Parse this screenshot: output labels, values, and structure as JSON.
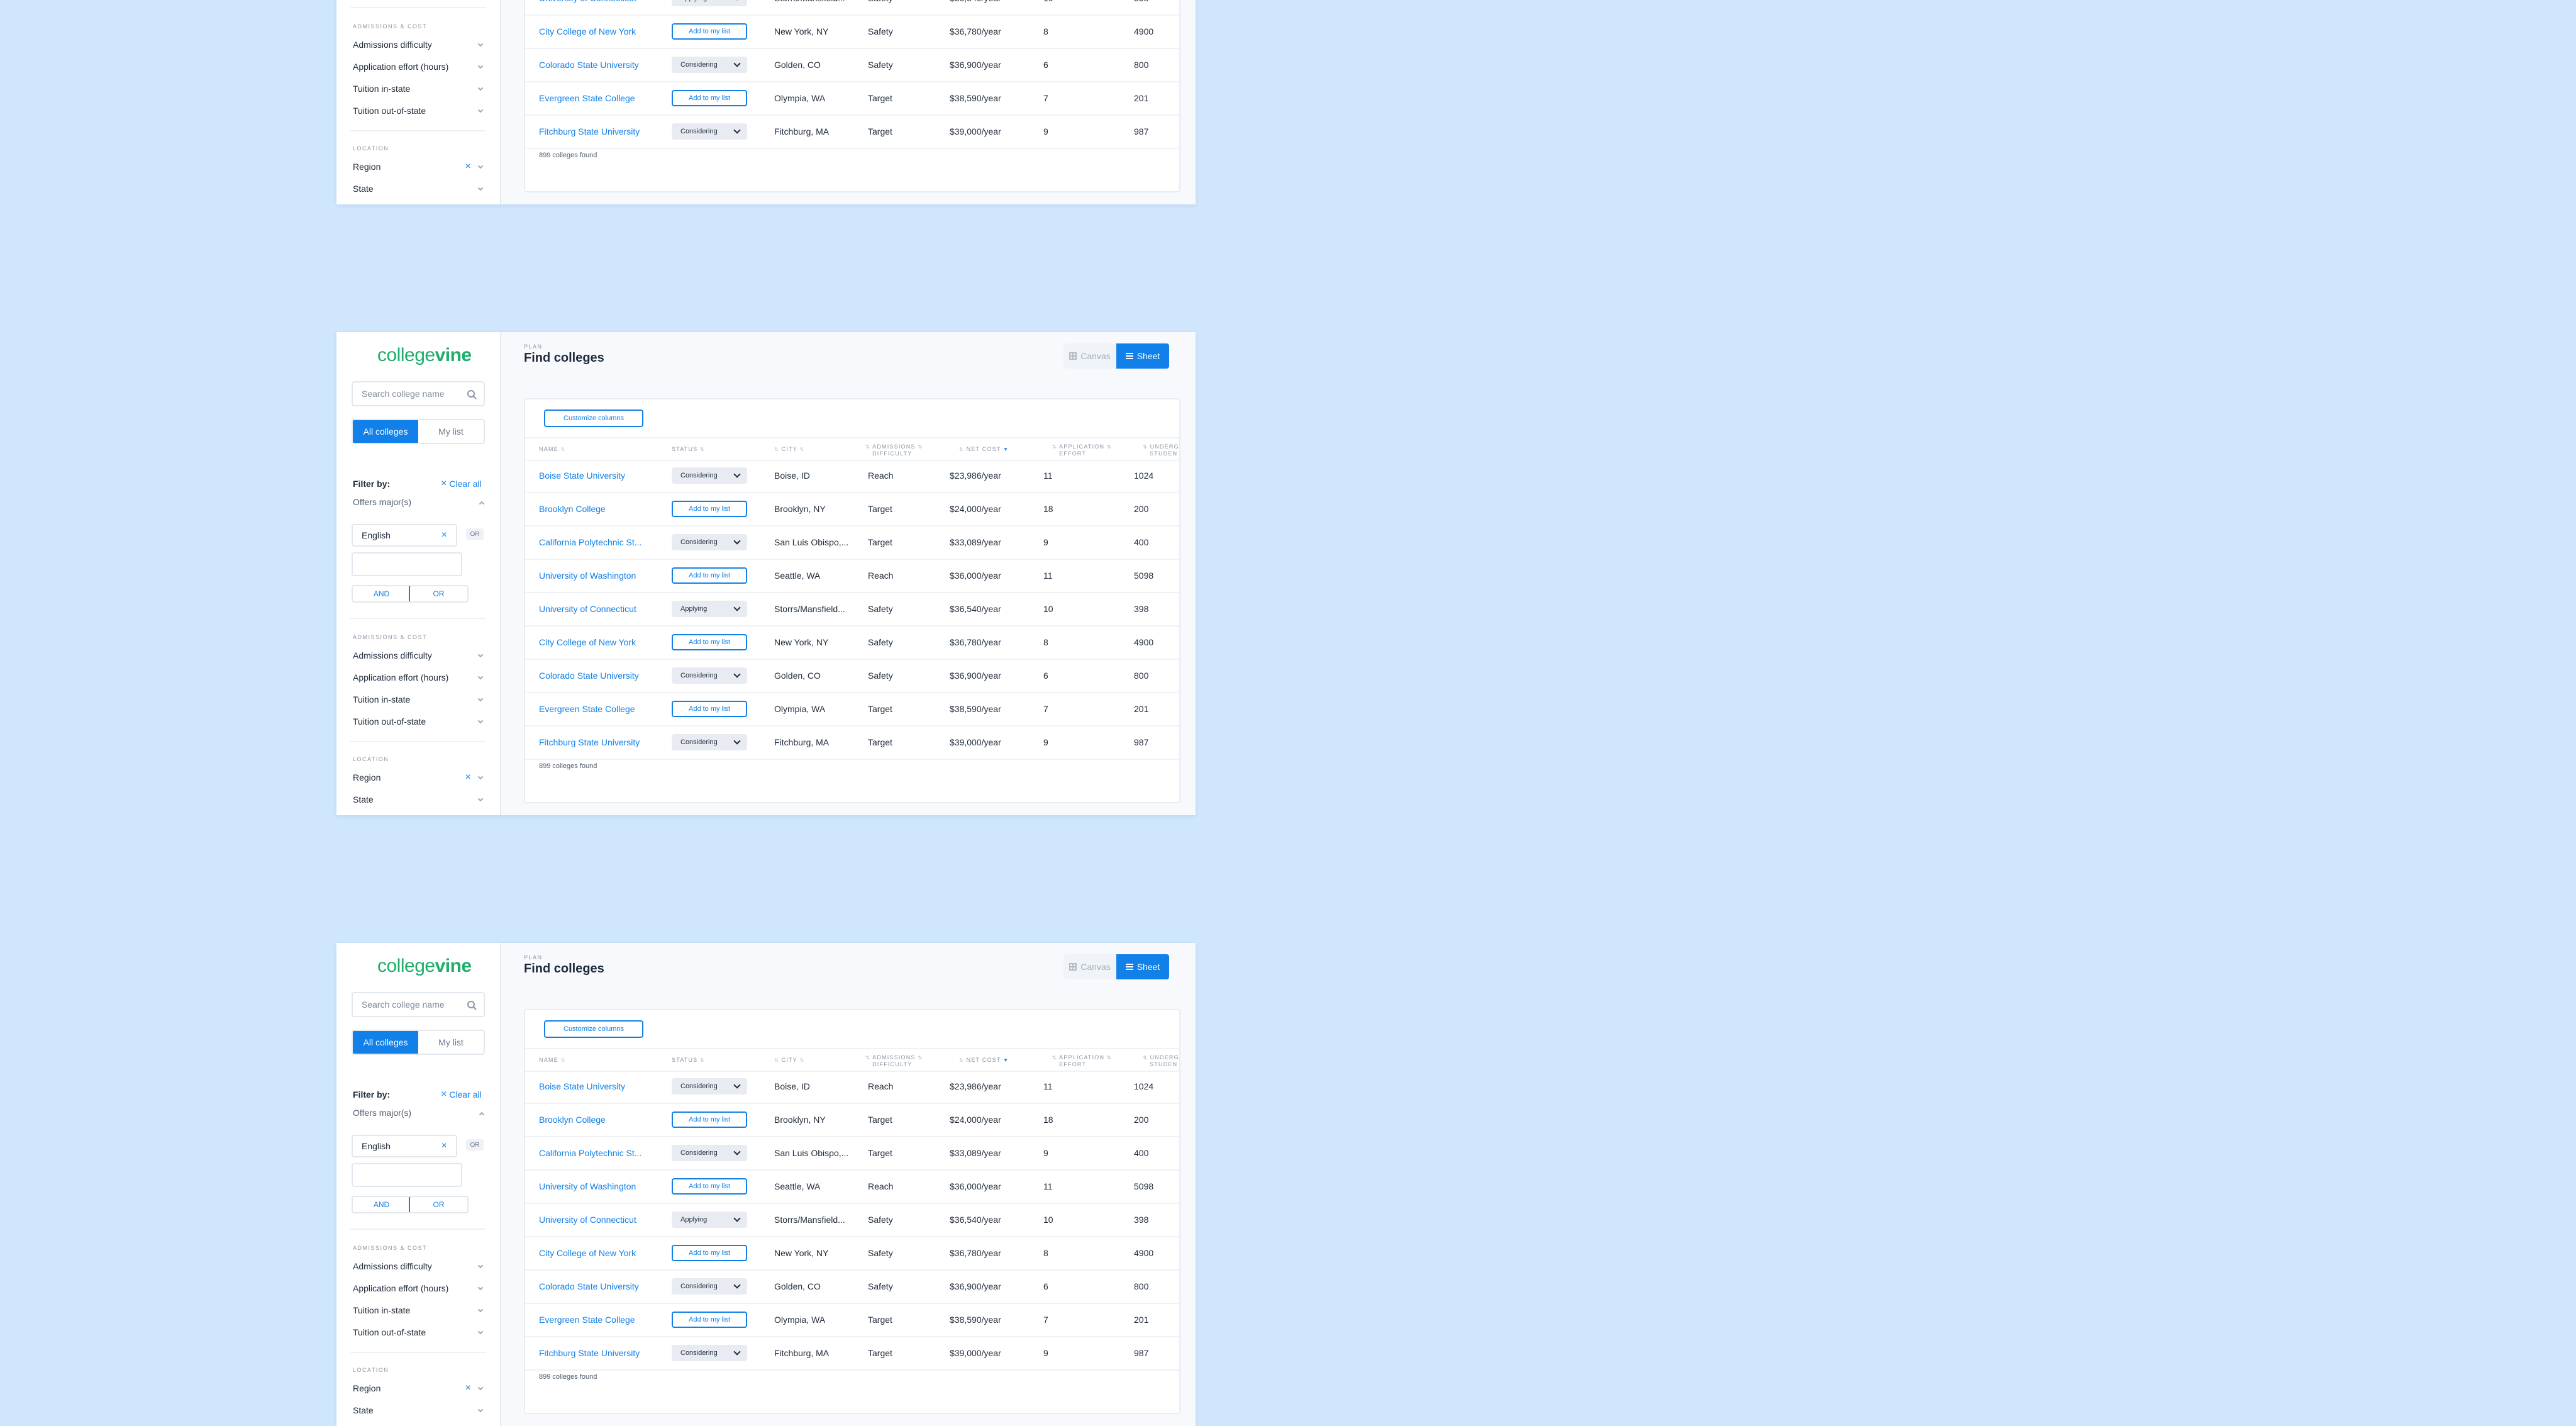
{
  "app": {
    "logo_prefix": "college",
    "logo_suffix": "vine",
    "plan_label": "PLAN",
    "page_title": "Find colleges",
    "view_canvas_label": "Canvas",
    "view_sheet_label": "Sheet"
  },
  "sidebar": {
    "search_placeholder": "Search college name",
    "tab_all": "All colleges",
    "tab_mylist": "My list",
    "filter_by": "Filter by:",
    "clear_all": "Clear all",
    "offers_majors": "Offers major(s)",
    "major_value": "English",
    "or_tag": "OR",
    "and_label": "AND",
    "or_label": "OR",
    "section_admissions": "ADMISSIONS & COST",
    "admissions_difficulty": "Admissions difficulty",
    "application_effort": "Application effort (hours)",
    "tuition_in_state": "Tuition in-state",
    "tuition_out_state": "Tuition out-of-state",
    "section_location": "LOCATION",
    "region": "Region",
    "state": "State"
  },
  "table": {
    "customize_label": "Customize columns",
    "columns": {
      "name": "NAME",
      "status": "STATUS",
      "city": "CITY",
      "admissions_1": "ADMISSIONS",
      "admissions_2": "DIFFICULTY",
      "net_cost": "NET COST",
      "effort_1": "APPLICATION",
      "effort_2": "EFFORT",
      "students_1": "UNDERG",
      "students_2": "STUDEN"
    },
    "rows": [
      {
        "name": "Boise State University",
        "status": "Considering",
        "city": "Boise, ID",
        "difficulty": "Reach",
        "cost": "$23,986/year",
        "effort": "11",
        "students": "1024"
      },
      {
        "name": "Brooklyn College",
        "status": "Add to my list",
        "city": "Brooklyn, NY",
        "difficulty": "Target",
        "cost": "$24,000/year",
        "effort": "18",
        "students": "200"
      },
      {
        "name": "California Polytechnic St...",
        "status": "Considering",
        "city": "San Luis Obispo,...",
        "difficulty": "Target",
        "cost": "$33,089/year",
        "effort": "9",
        "students": "400"
      },
      {
        "name": "University of Washington",
        "status": "Add to my list",
        "city": "Seattle, WA",
        "difficulty": "Reach",
        "cost": "$36,000/year",
        "effort": "11",
        "students": "5098"
      },
      {
        "name": "University of Connecticut",
        "status": "Applying",
        "city": "Storrs/Mansfield...",
        "difficulty": "Safety",
        "cost": "$36,540/year",
        "effort": "10",
        "students": "398"
      },
      {
        "name": "City College of New York",
        "status": "Add to my list",
        "city": "New York, NY",
        "difficulty": "Safety",
        "cost": "$36,780/year",
        "effort": "8",
        "students": "4900"
      },
      {
        "name": "Colorado State University",
        "status": "Considering",
        "city": "Golden, CO",
        "difficulty": "Safety",
        "cost": "$36,900/year",
        "effort": "6",
        "students": "800"
      },
      {
        "name": "Evergreen State College",
        "status": "Add to my list",
        "city": "Olympia, WA",
        "difficulty": "Target",
        "cost": "$38,590/year",
        "effort": "7",
        "students": "201"
      },
      {
        "name": "Fitchburg State University",
        "status": "Considering",
        "city": "Fitchburg, MA",
        "difficulty": "Target",
        "cost": "$39,000/year",
        "effort": "9",
        "students": "987"
      }
    ],
    "found_text": "899 colleges found"
  },
  "colors": {
    "background": "#cfe6fc",
    "accent": "#1180e8",
    "brand_green": "#1fae6b"
  }
}
